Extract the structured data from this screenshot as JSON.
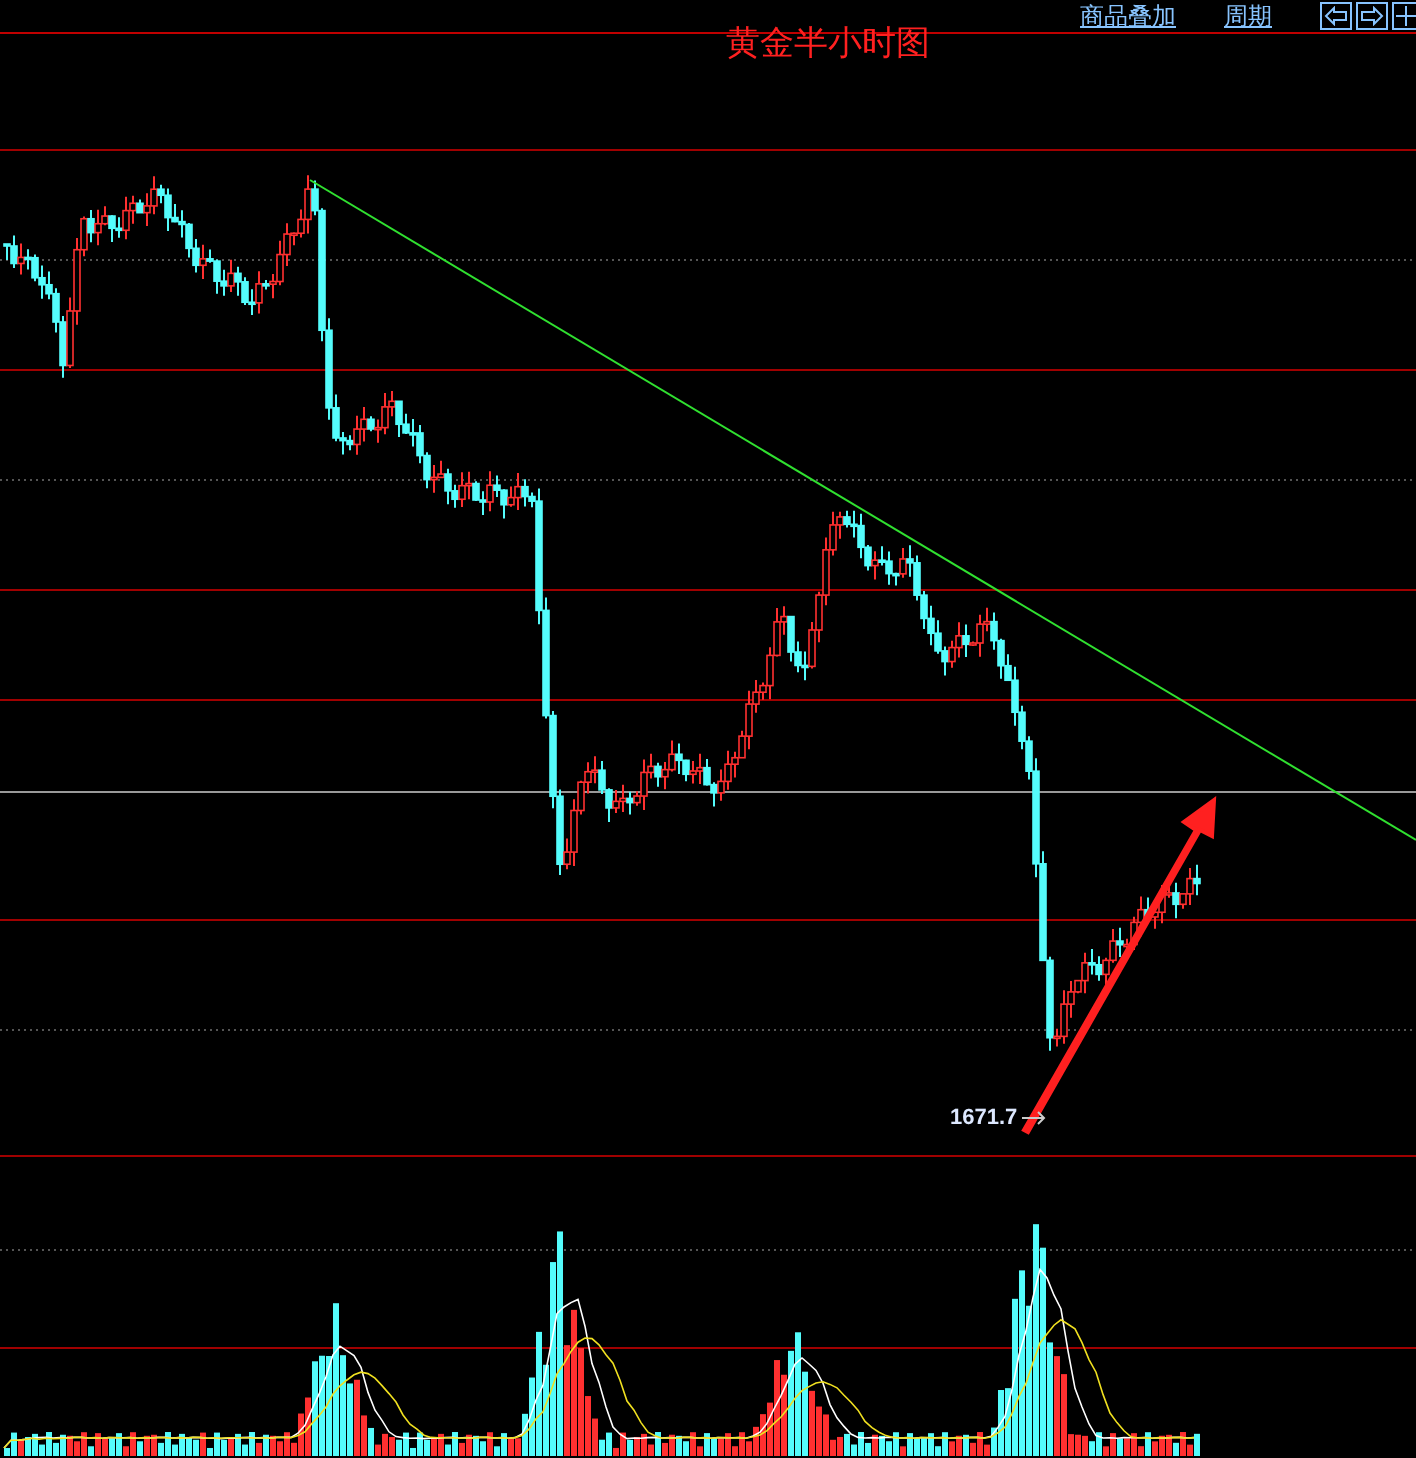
{
  "toolbar": {
    "links": [
      "商品叠加",
      "周期"
    ]
  },
  "chart": {
    "title": "黄金半小时图",
    "low_label": "1671.7"
  }
}
